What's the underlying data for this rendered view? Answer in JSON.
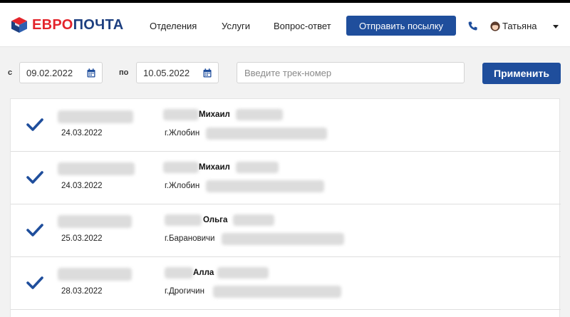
{
  "header": {
    "logo_text_red": "ЕВРО",
    "logo_text_blue": "ПОЧТА",
    "nav": [
      "Отделения",
      "Услуги",
      "Вопрос-ответ"
    ],
    "send_button": "Отправить посылку",
    "user_name": "Татьяна",
    "icons": {
      "phone": "phone-icon",
      "avatar": "avatar-icon",
      "menu": "chevron-down-icon"
    },
    "colors": {
      "brand_blue": "#1f4e9c",
      "logo_red": "#e3242b",
      "logo_blue": "#1d3f80"
    }
  },
  "filters": {
    "from_label": "с",
    "to_label": "по",
    "date_from": "09.02.2022",
    "date_to": "10.05.2022",
    "track_placeholder": "Введите трек-номер",
    "apply_button": "Применить"
  },
  "shipments": [
    {
      "date": "24.03.2022",
      "name": "Михаил",
      "city": "г.Жлобин"
    },
    {
      "date": "24.03.2022",
      "name": "Михаил",
      "city": "г.Жлобин"
    },
    {
      "date": "25.03.2022",
      "name": "Ольга",
      "city": "г.Барановичи"
    },
    {
      "date": "28.03.2022",
      "name": "Алла",
      "city": "г.Дрогичин"
    }
  ]
}
